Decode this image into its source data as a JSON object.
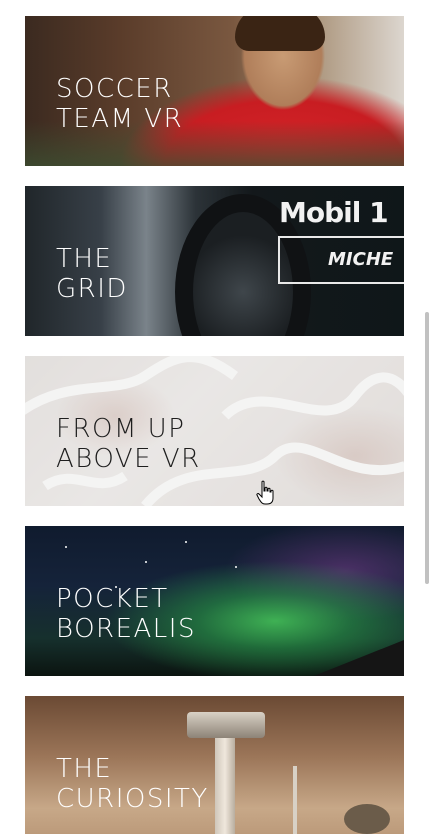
{
  "cards": [
    {
      "title": "SOCCER\nTEAM VR",
      "image": "soccer-player-photo"
    },
    {
      "title": "THE\nGRID",
      "image": "race-car-tire-photo",
      "logo_text": "Mobil 1",
      "logo_text2": "MICHE"
    },
    {
      "title": "FROM UP\nABOVE VR",
      "image": "aerial-winding-roads-photo"
    },
    {
      "title": "POCKET\nBOREALIS",
      "image": "aurora-night-sky-photo"
    },
    {
      "title": "THE\nCURIOSITY",
      "image": "mars-rover-photo"
    }
  ],
  "icons": {
    "cursor": "hand-pointer-icon"
  }
}
